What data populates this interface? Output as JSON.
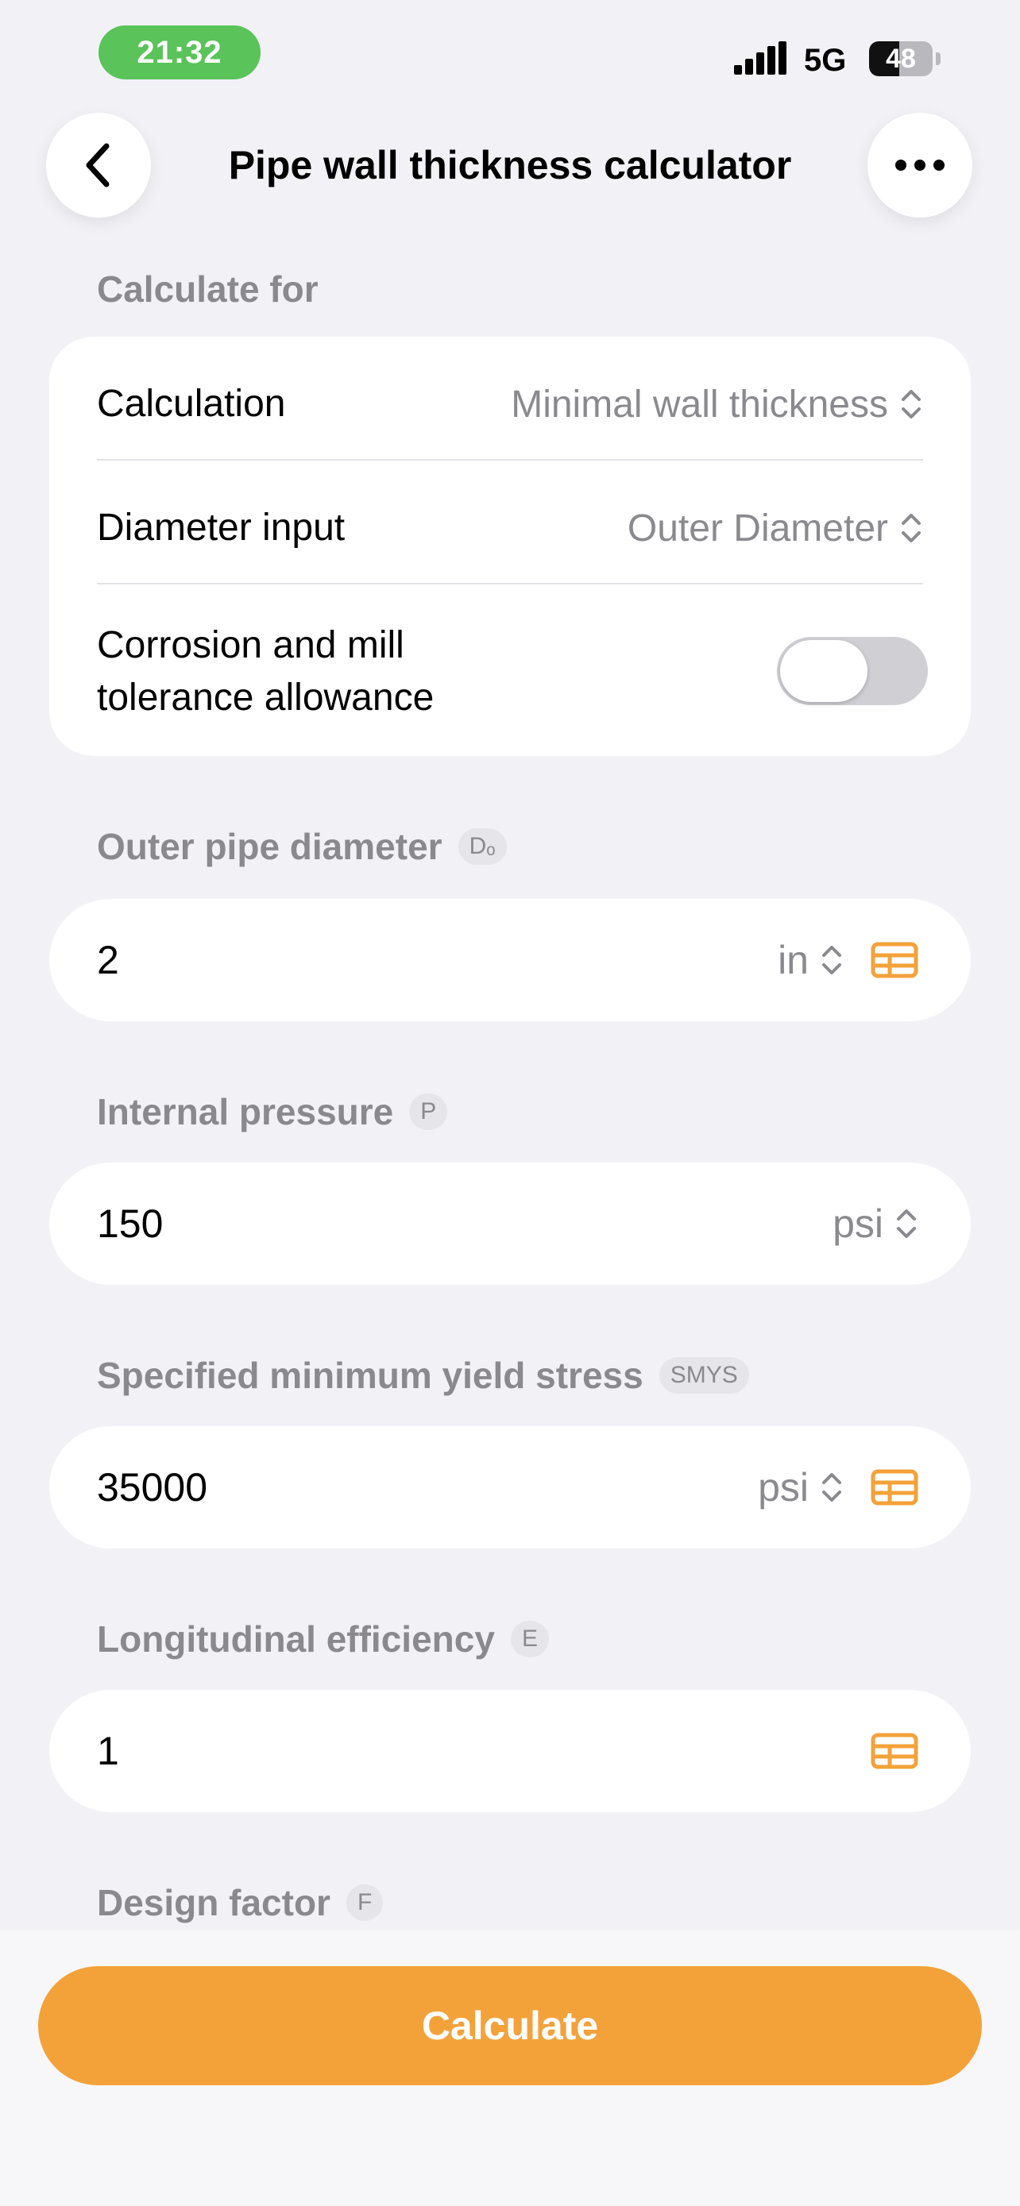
{
  "status_bar": {
    "time": "21:32",
    "network": "5G",
    "battery": "48",
    "battery_level": 0.48
  },
  "nav": {
    "title": "Pipe wall thickness calculator",
    "back_icon": "chevron-left-icon",
    "more_icon": "ellipsis-icon"
  },
  "calculate_for": {
    "label": "Calculate for",
    "calculation": {
      "label": "Calculation",
      "value": "Minimal wall thickness"
    },
    "diameter_input": {
      "label": "Diameter input",
      "value": "Outer Diameter"
    },
    "corrosion": {
      "label_line1": "Corrosion and mill",
      "label_line2": "tolerance allowance",
      "enabled": false
    }
  },
  "fields": {
    "outer_diameter": {
      "label": "Outer pipe diameter",
      "symbol": "Dₒ",
      "value": "2",
      "unit": "in"
    },
    "internal_pressure": {
      "label": "Internal pressure",
      "symbol": "P",
      "value": "150",
      "unit": "psi"
    },
    "smys": {
      "label": "Specified minimum yield stress",
      "symbol": "SMYS",
      "value": "35000",
      "unit": "psi"
    },
    "longitudinal_efficiency": {
      "label": "Longitudinal efficiency",
      "symbol": "E",
      "value": "1"
    },
    "design_factor": {
      "label": "Design factor",
      "symbol": "F"
    }
  },
  "actions": {
    "calculate": "Calculate"
  },
  "colors": {
    "accent": "#f3a23a",
    "time_pill": "#5ac35a",
    "background": "#f2f2f6"
  }
}
